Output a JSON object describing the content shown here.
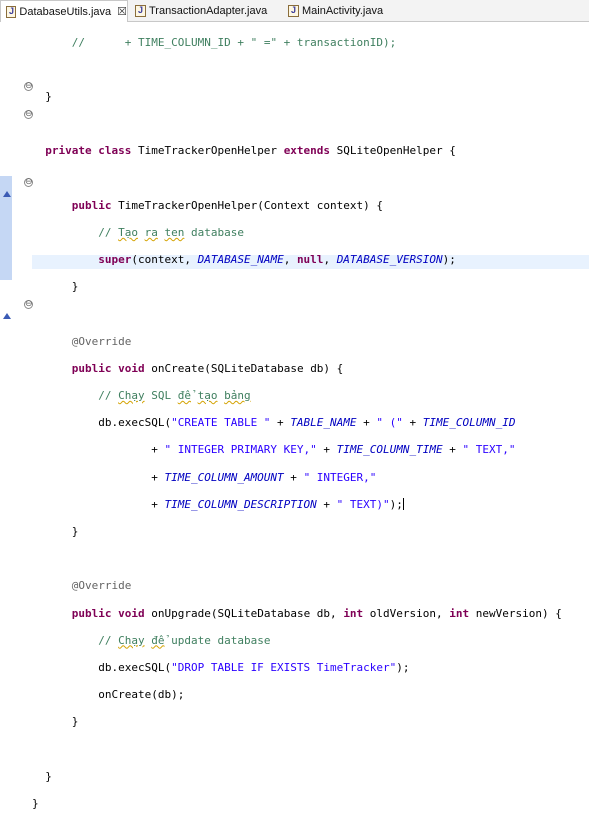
{
  "tabs": [
    {
      "label": "DatabaseUtils.java",
      "active": true,
      "close": "☒"
    },
    {
      "label": "TransactionAdapter.java",
      "active": false
    },
    {
      "label": "MainActivity.java",
      "active": false
    }
  ],
  "code": {
    "l1": [
      "//      + ",
      "TIME_COLUMN_ID",
      " + \" =\" + transactionID);"
    ],
    "l2": "}",
    "l3": [
      "private",
      " ",
      "class",
      " TimeTrackerOpenHelper ",
      "extends",
      " SQLiteOpenHelper {"
    ],
    "l4": [
      "public",
      " TimeTrackerOpenHelper(Context context) {"
    ],
    "l5": [
      "// ",
      "Tạo",
      " ",
      "ra",
      " ",
      "ten",
      " database"
    ],
    "l6": [
      "super",
      "(context, ",
      "DATABASE_NAME",
      ", ",
      "null",
      ", ",
      "DATABASE_VERSION",
      ");"
    ],
    "l7": "}",
    "l8": "@Override",
    "l9": [
      "public",
      " ",
      "void",
      " onCreate(SQLiteDatabase db) {"
    ],
    "l10": [
      "// ",
      "Chạy",
      " SQL ",
      "để",
      " ",
      "tạo",
      " ",
      "bảng"
    ],
    "l11": [
      "db.execSQL(",
      "\"CREATE TABLE \"",
      " + ",
      "TABLE_NAME",
      " + ",
      "\" (\"",
      " + ",
      "TIME_COLUMN_ID"
    ],
    "l12": [
      "+ ",
      "\" INTEGER PRIMARY KEY,\"",
      " + ",
      "TIME_COLUMN_TIME",
      " + ",
      "\" TEXT,\""
    ],
    "l13": [
      "+ ",
      "TIME_COLUMN_AMOUNT",
      " + ",
      "\" INTEGER,\""
    ],
    "l14": [
      "+ ",
      "TIME_COLUMN_DESCRIPTION",
      " + ",
      "\" TEXT)\"",
      ");"
    ],
    "l15": "}",
    "l16": "@Override",
    "l17": [
      "public",
      " ",
      "void",
      " onUpgrade(SQLiteDatabase db, ",
      "int",
      " oldVersion, ",
      "int",
      " newVersion) {"
    ],
    "l18": [
      "// ",
      "Chạy",
      " ",
      "để",
      " update database"
    ],
    "l19": [
      "db.execSQL(",
      "\"DROP TABLE IF EXISTS TimeTracker\"",
      ");"
    ],
    "l20": "onCreate(db);",
    "l21": "}",
    "l22": "}",
    "l23": "}"
  },
  "gutter": {
    "fold_symbol": "⊖"
  },
  "colors": {
    "keyword": "#7f0055",
    "string": "#2a00ff",
    "comment": "#3f7f5f",
    "constant": "#0000c0",
    "annotation": "#646464",
    "current_line": "#e8f2fe"
  }
}
